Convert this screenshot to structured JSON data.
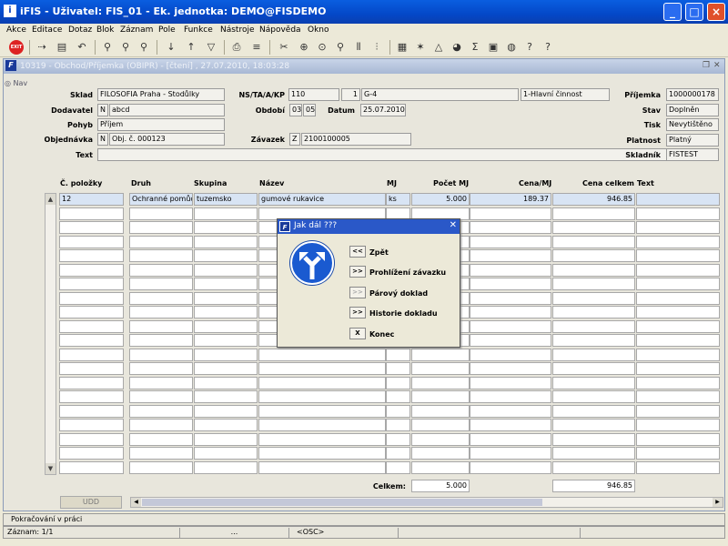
{
  "window": {
    "title": "iFIS - Uživatel: FIS_01 - Ek. jednotka: DEMO@FISDEMO",
    "app_icon": "i"
  },
  "menu": [
    "Akce",
    "Editace",
    "Dotaz",
    "Blok",
    "Záznam",
    "Pole",
    "Funkce",
    "Nástroje",
    "Nápověda",
    "Okno"
  ],
  "toolbar": {
    "exit_label": "EXIT"
  },
  "subwindow": {
    "title": "10319 - Obchod/Příjemka (OBIPR) - [čtení] , 27.07.2010, 18:03:28",
    "icon": "F"
  },
  "nav_label": "Nav",
  "form": {
    "sklad_label": "Sklad",
    "sklad": "FILOSOFIA Praha - Stodůlky",
    "dodavatel_label": "Dodavatel",
    "dodavatel_flag": "N",
    "dodavatel": "abcd",
    "pohyb_label": "Pohyb",
    "pohyb": "Příjem",
    "objednavka_label": "Objednávka",
    "objednavka_flag": "N",
    "objednavka": "Obj. č. 000123",
    "text_label": "Text",
    "text": "",
    "ns_label": "NS/TA/A/KP",
    "ns": "110",
    "ta": "1",
    "a": "G-4",
    "kp": "1-Hlavní činnost",
    "obdobi_label": "Období",
    "obdobi_1": "03",
    "obdobi_2": "05",
    "datum_label": "Datum",
    "datum": "25.07.2010",
    "zavazek_label": "Závazek",
    "zavazek_flag": "Z",
    "zavazek": "2100100005",
    "prijemka_label": "Příjemka",
    "prijemka": "1000000178",
    "stav_label": "Stav",
    "stav": "Doplněn",
    "tisk_label": "Tisk",
    "tisk": "Nevytištěno",
    "platnost_label": "Platnost",
    "platnost": "Platný",
    "skladnik_label": "Skladník",
    "skladnik": "FISTEST"
  },
  "table": {
    "columns": [
      "Č. položky",
      "Druh",
      "Skupina",
      "Název",
      "MJ",
      "Počet MJ",
      "Cena/MJ",
      "Cena celkem",
      "Text"
    ],
    "rows": [
      {
        "c": "12",
        "druh": "Ochranné pomůcky",
        "skupina": "tuzemsko",
        "nazev": "gumové rukavice",
        "mj": "ks",
        "pocet": "5.000",
        "cena_mj": "189.37",
        "cena_celkem": "946.85",
        "text": ""
      }
    ]
  },
  "totals": {
    "label": "Celkem:",
    "pocet": "5.000",
    "cena_celkem": "946.85"
  },
  "udd_label": "UDD",
  "dialog": {
    "title": "Jak dál ???",
    "options": [
      {
        "btn": "<<",
        "label": "Zpět",
        "enabled": true
      },
      {
        "btn": ">>",
        "label": "Prohlížení závazku",
        "enabled": true
      },
      {
        "btn": ">>",
        "label": "Párový doklad",
        "enabled": false
      },
      {
        "btn": ">>",
        "label": "Historie dokladu",
        "enabled": true
      },
      {
        "btn": "X",
        "label": "Konec",
        "enabled": true
      }
    ]
  },
  "status": {
    "message": "Pokračování v práci",
    "zaznam": "Záznam: 1/1",
    "s2": "...",
    "s3": "<OSC>"
  }
}
